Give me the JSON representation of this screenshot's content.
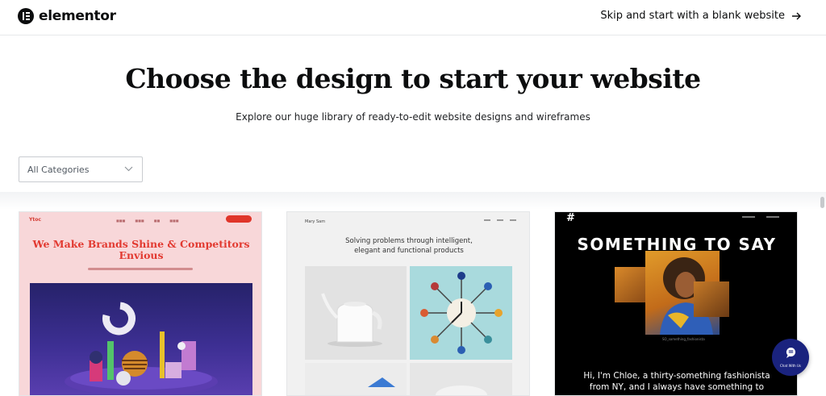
{
  "header": {
    "brand": "elementor",
    "skip_label": "Skip and start with a blank website"
  },
  "hero": {
    "title": "Choose the design to start your website",
    "subtitle": "Explore our huge library of ready-to-edit website designs and wireframes"
  },
  "filter": {
    "category_value": "All Categories"
  },
  "templates": [
    {
      "logo": "Ytoc",
      "title": "We Make Brands Shine & Competitors Envious",
      "accent": "#e23a31"
    },
    {
      "logo": "Mary Sam",
      "title": "Solving problems through intelligent, elegant and functional products"
    },
    {
      "logo": "#",
      "title": "SOMETHING TO SAY",
      "caption": "SO_something_fashionista",
      "body": "Hi, I'm Chloe, a thirty-something fashionista from NY, and I always have something to"
    }
  ],
  "chat": {
    "label": "Chat With Us",
    "color": "#1a237e"
  }
}
